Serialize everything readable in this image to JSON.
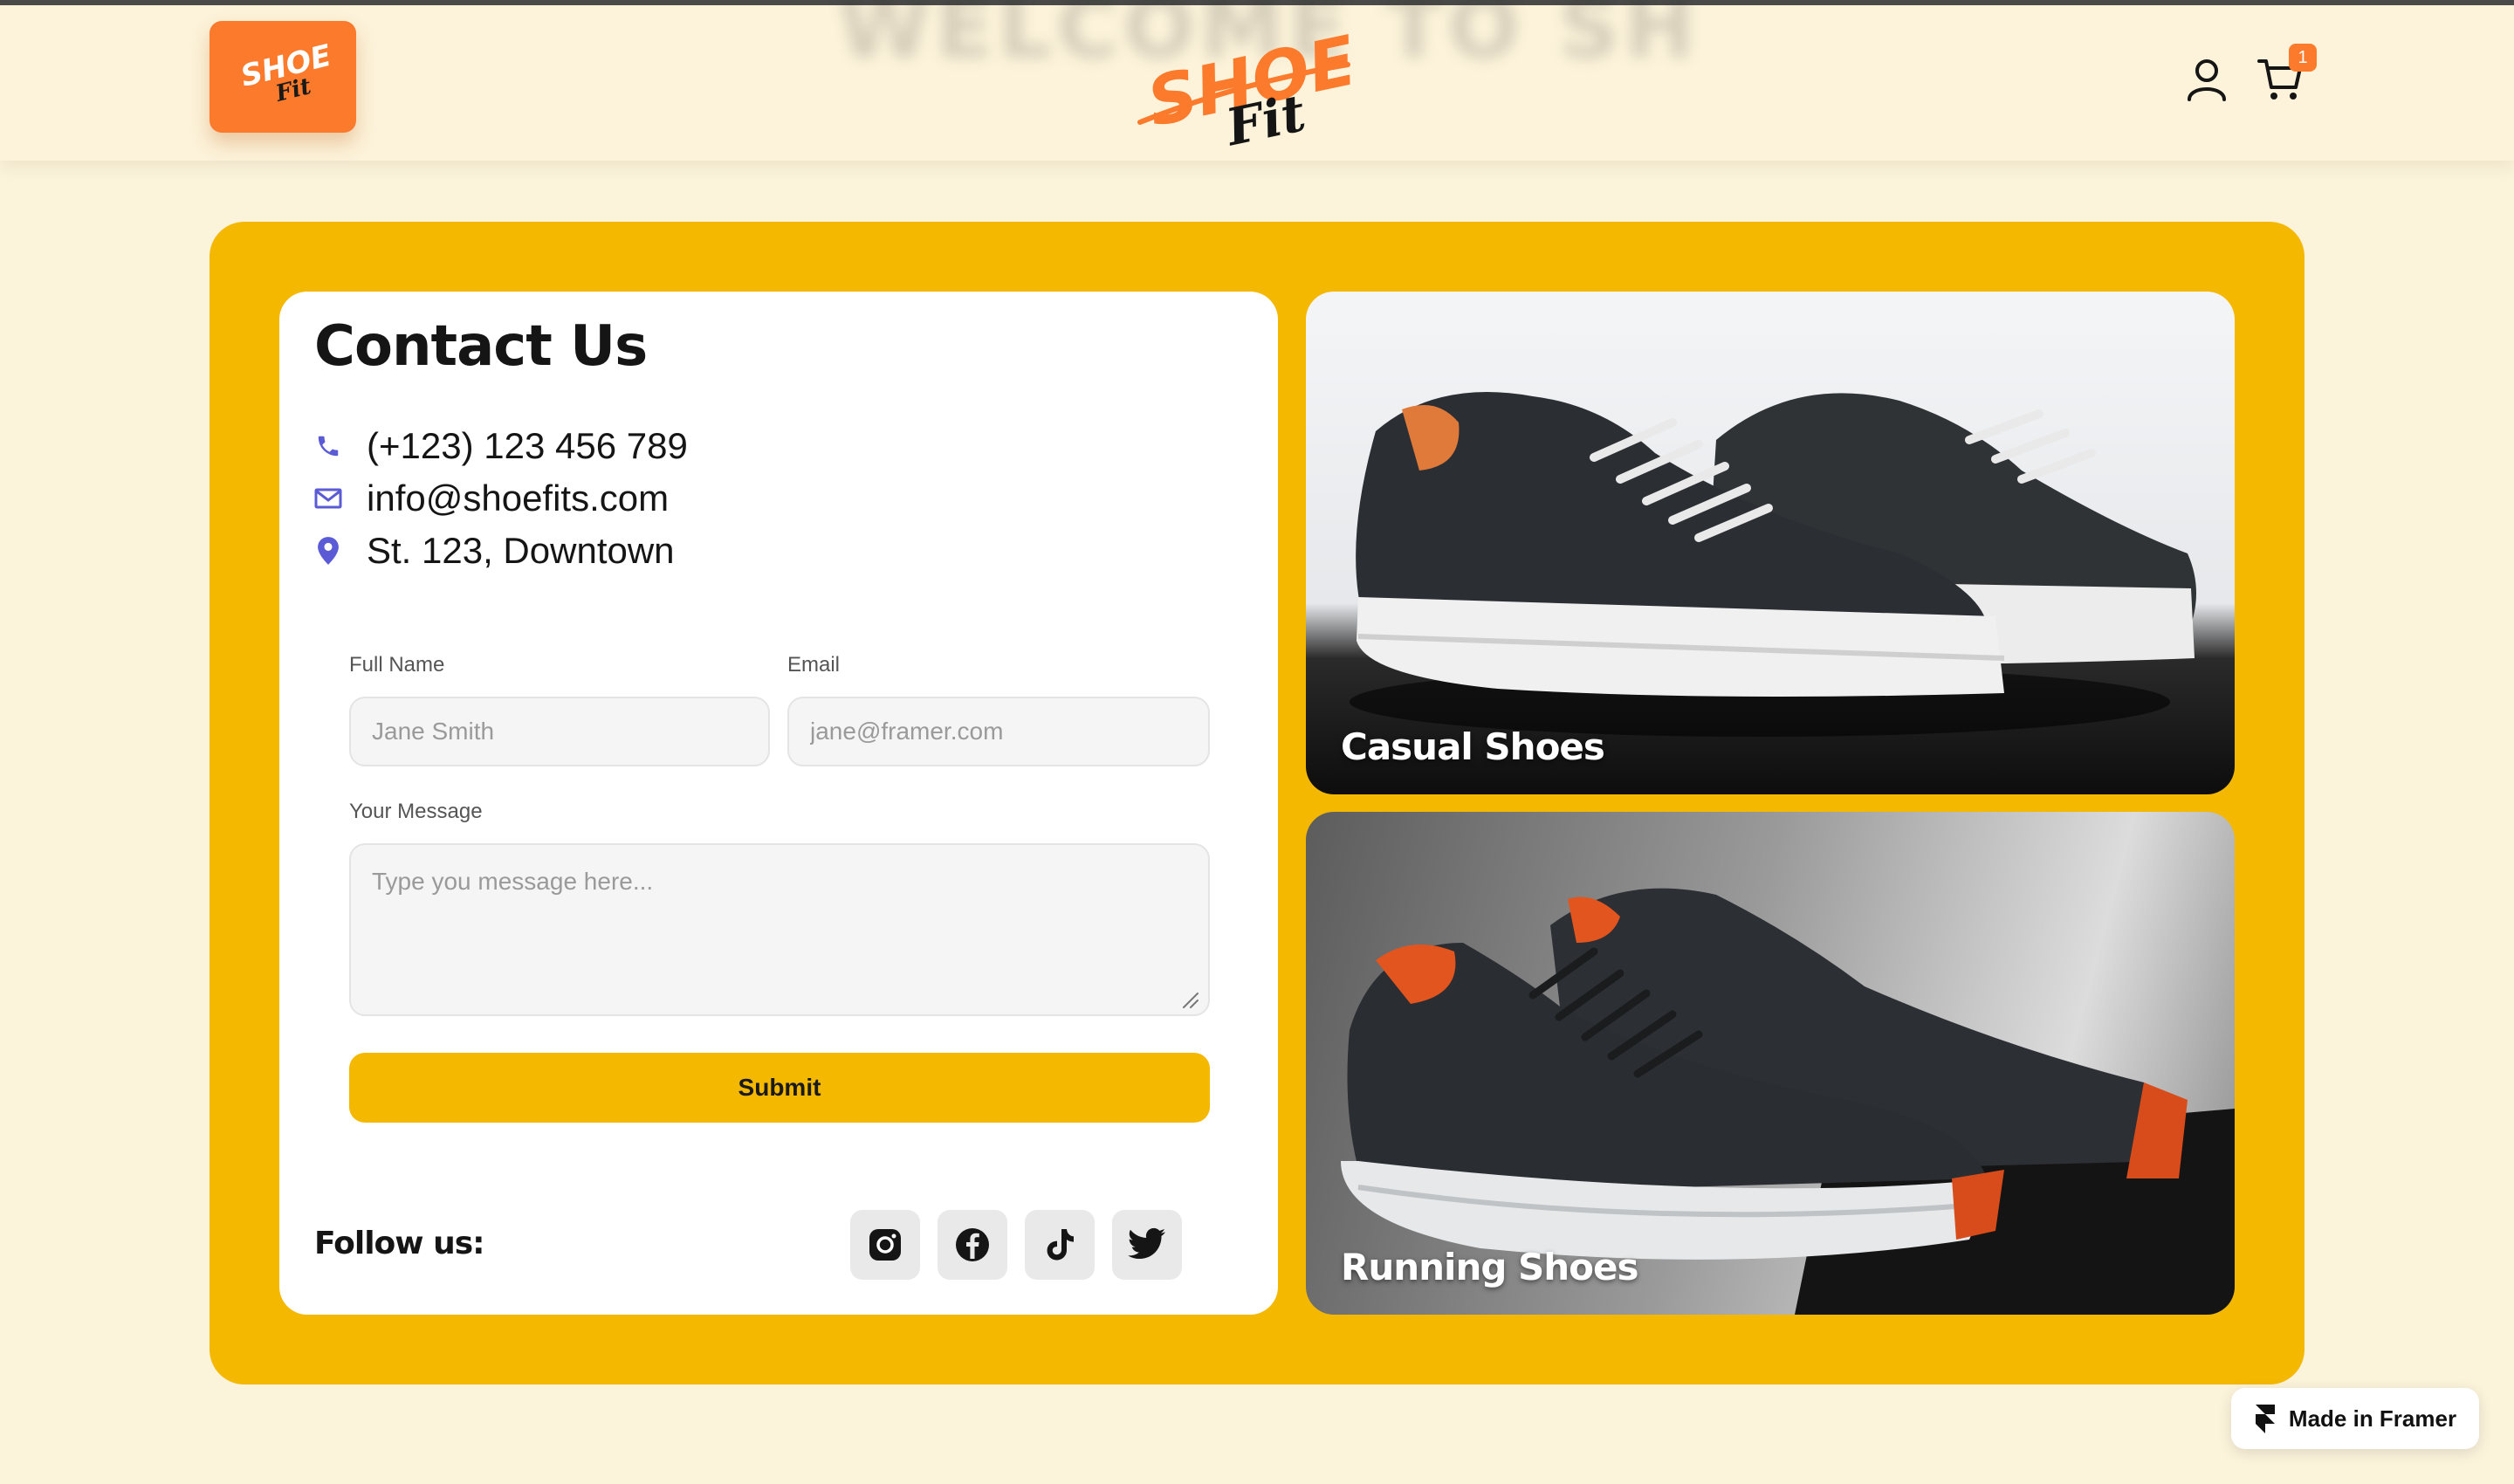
{
  "header": {
    "ghost_title": "WELCOME TO SHOE FIT",
    "brand": {
      "line1": "SHOE",
      "line2": "Fit"
    },
    "cart_count": "1",
    "icons": [
      "user-icon",
      "cart-icon"
    ]
  },
  "contact": {
    "title": "Contact Us",
    "phone": "(+123) 123 456 789",
    "email": "info@shoefits.com",
    "address": "St. 123, Downtown",
    "icons": [
      "phone-icon",
      "mail-icon",
      "location-pin-icon"
    ]
  },
  "form": {
    "full_name_label": "Full Name",
    "full_name_placeholder": "Jane Smith",
    "email_label": "Email",
    "email_placeholder": "jane@framer.com",
    "message_label": "Your Message",
    "message_placeholder": "Type you message here...",
    "submit_label": "Submit"
  },
  "social": {
    "label": "Follow us:",
    "icons": [
      "instagram-icon",
      "facebook-icon",
      "tiktok-icon",
      "twitter-icon"
    ]
  },
  "products": [
    {
      "label": "Casual Shoes"
    },
    {
      "label": "Running Shoes"
    }
  ],
  "framer_badge": "Made in Framer",
  "colors": {
    "page_bg": "#fbf3da",
    "panel_yellow": "#f4b800",
    "brand_orange": "#fb7a2b",
    "icon_accent": "#5b5bd6"
  }
}
